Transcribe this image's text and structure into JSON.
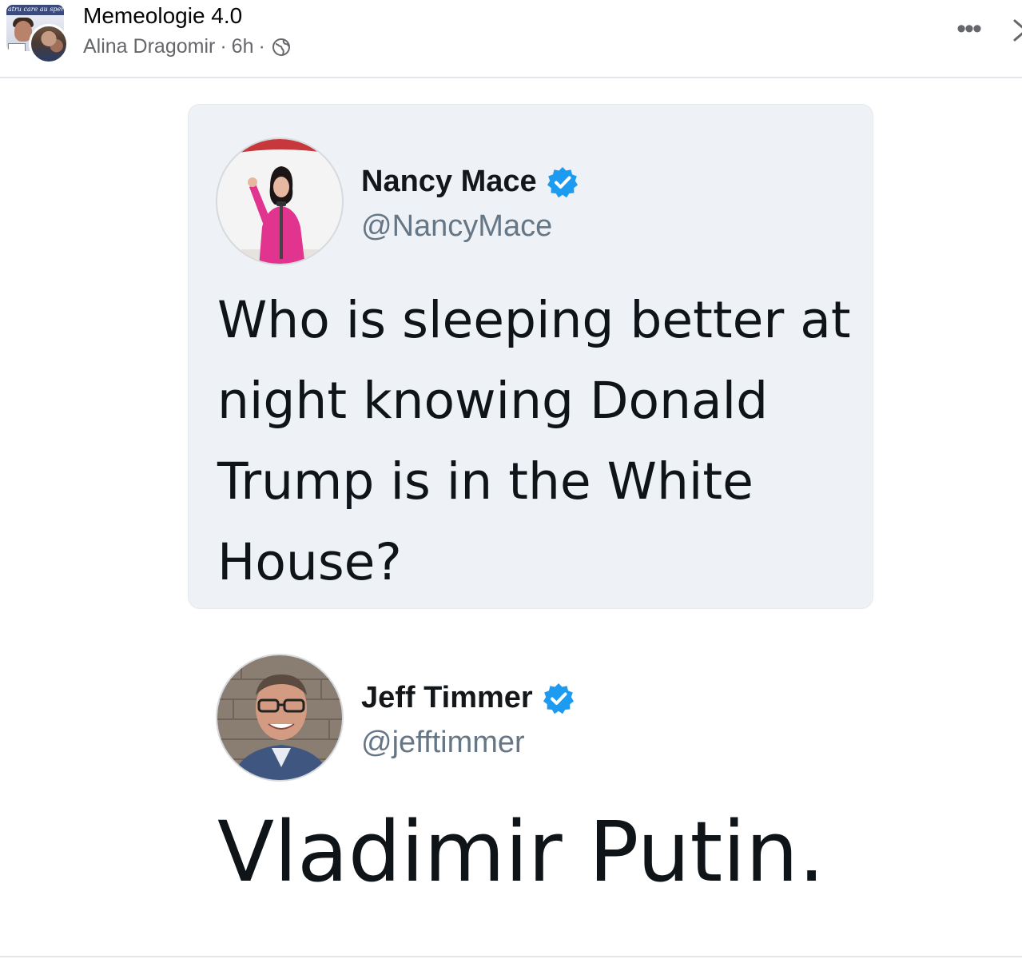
{
  "post": {
    "group_name": "Memeologie 4.0",
    "author": "Alina Dragomir",
    "dot": "·",
    "time": "6h",
    "privacy_icon": "globe-icon",
    "group_avatar_text": "atru care au sperat"
  },
  "actions": {
    "more_label": "•••",
    "close_icon": "close-icon"
  },
  "tweets": [
    {
      "name": "Nancy Mace",
      "handle": "@NancyMace",
      "verified": true,
      "text": "Who is sleeping better at night knowing Donald Trump is in the White House?"
    },
    {
      "name": "Jeff Timmer",
      "handle": "@jefftimmer",
      "verified": true,
      "text": "Vladimir Putin."
    }
  ],
  "colors": {
    "verified_blue": "#1d9bf0",
    "card_bg": "#eef1f5",
    "meta_gray": "#65676b"
  }
}
